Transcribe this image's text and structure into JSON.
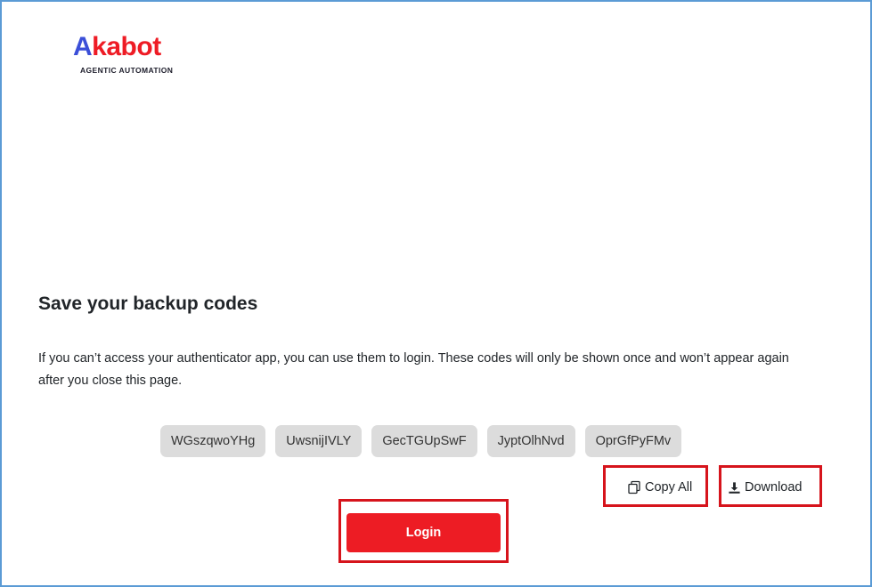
{
  "brand": {
    "logo_first": "A",
    "logo_rest": "kabot",
    "tagline": "AGENTIC AUTOMATION",
    "colors": {
      "primary": "#ed1c24",
      "secondary": "#3b4fd8"
    }
  },
  "page": {
    "title": "Save your backup codes",
    "description": "If you can’t access your authenticator app, you can use them to login. These codes will only be shown once and won’t appear again after you close this page."
  },
  "backup_codes": [
    "WGszqwoYHg",
    "UwsnijIVLY",
    "GecTGUpSwF",
    "JyptOlhNvd",
    "OprGfPyFMv"
  ],
  "actions": {
    "copy_all_label": "Copy All",
    "copy_icon": "copy-icon",
    "download_label": "Download",
    "download_icon": "download-icon",
    "login_label": "Login"
  },
  "annotation": {
    "highlight_color": "#d6141c"
  }
}
